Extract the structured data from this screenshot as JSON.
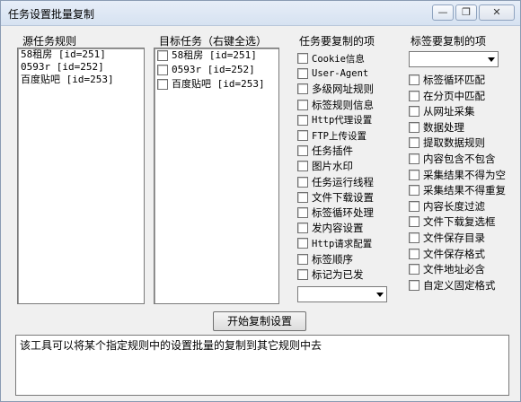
{
  "window": {
    "title": "任务设置批量复制",
    "minimize": "—",
    "restore": "❐",
    "close": "✕"
  },
  "source": {
    "label": "源任务规则",
    "items": [
      "58租房 [id=251]",
      "0593r [id=252]",
      "百度贴吧 [id=253]"
    ]
  },
  "target": {
    "label": "目标任务（右键全选）",
    "items": [
      "58租房 [id=251]",
      "0593r [id=252]",
      "百度贴吧 [id=253]"
    ]
  },
  "task_copy": {
    "label": "任务要复制的项",
    "items": [
      "Cookie信息",
      "User-Agent",
      "多级网址规则",
      "标签规则信息",
      "Http代理设置",
      "FTP上传设置",
      "任务插件",
      "图片水印",
      "任务运行线程",
      "文件下载设置",
      "标签循环处理",
      "发内容设置",
      "Http请求配置",
      "标签顺序",
      "标记为已发"
    ],
    "dropdown_value": ""
  },
  "tag_copy": {
    "label": "标签要复制的项",
    "dropdown_value": "",
    "items": [
      "标签循环匹配",
      "在分页中匹配",
      "从网址采集",
      "数据处理",
      "提取数据规则",
      "内容包含不包含",
      "采集结果不得为空",
      "采集结果不得重复",
      "内容长度过滤",
      "文件下载复选框",
      "文件保存目录",
      "文件保存格式",
      "文件地址必含",
      "自定义固定格式"
    ]
  },
  "start_button": "开始复制设置",
  "info_text": "该工具可以将某个指定规则中的设置批量的复制到其它规则中去"
}
